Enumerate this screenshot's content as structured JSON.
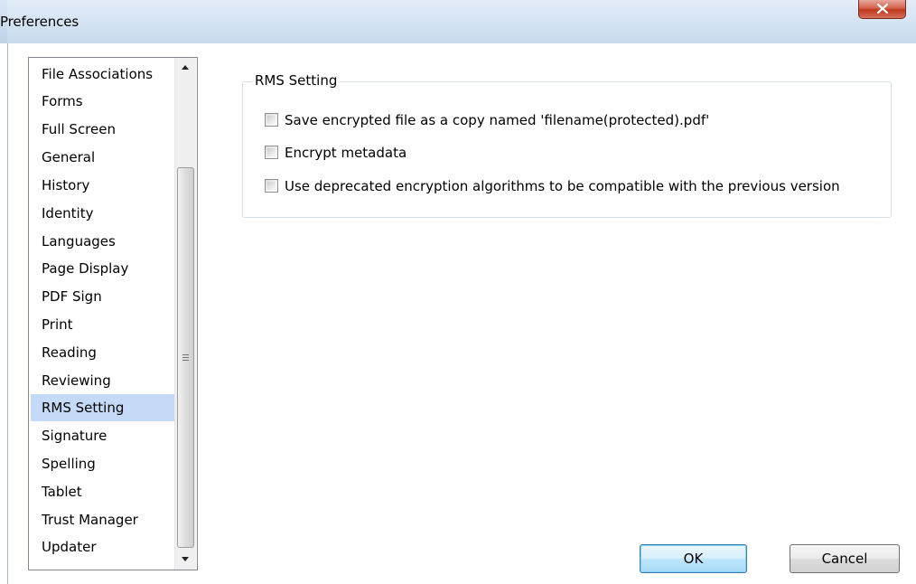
{
  "window": {
    "title": "Preferences",
    "close_icon": "close-x-icon"
  },
  "sidebar": {
    "items": [
      {
        "label": "File Associations"
      },
      {
        "label": "Forms"
      },
      {
        "label": "Full Screen"
      },
      {
        "label": "General"
      },
      {
        "label": "History"
      },
      {
        "label": "Identity"
      },
      {
        "label": "Languages"
      },
      {
        "label": "Page Display"
      },
      {
        "label": "PDF Sign"
      },
      {
        "label": "Print"
      },
      {
        "label": "Reading"
      },
      {
        "label": "Reviewing"
      },
      {
        "label": "RMS Setting",
        "selected": true
      },
      {
        "label": "Signature"
      },
      {
        "label": "Spelling"
      },
      {
        "label": "Tablet"
      },
      {
        "label": "Trust Manager"
      },
      {
        "label": "Updater"
      }
    ]
  },
  "rms": {
    "group_title": "RMS Setting",
    "options": [
      {
        "label": "Save encrypted file as a copy named 'filename(protected).pdf'",
        "checked": false
      },
      {
        "label": "Encrypt metadata",
        "checked": false
      },
      {
        "label": "Use deprecated encryption algorithms to be compatible with the previous version",
        "checked": false
      }
    ]
  },
  "buttons": {
    "ok": "OK",
    "cancel": "Cancel"
  },
  "colors": {
    "selection": "#c4daf7",
    "titlebar": "#d3e2f2",
    "close_button": "#c8452c"
  }
}
